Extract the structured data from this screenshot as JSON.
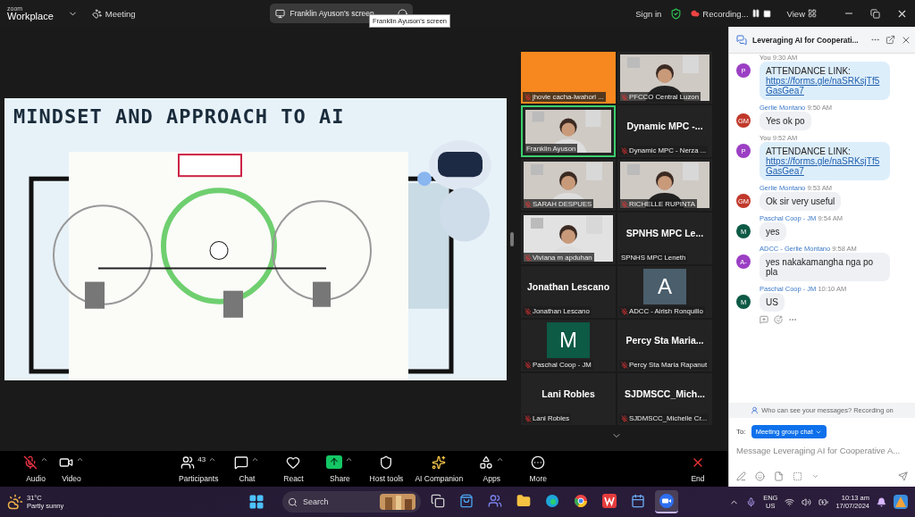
{
  "title_bar": {
    "brand_small": "zoom",
    "brand": "Workplace",
    "meeting_menu": "Meeting",
    "share_pill": "Franklin Ayuson's screen",
    "tooltip": "Franklin Ayuson's screen",
    "sign_in": "Sign in",
    "recording": "Recording...",
    "view": "View"
  },
  "slide": {
    "title": "MINDSET AND APPROACH TO AI"
  },
  "gallery": {
    "tiles": [
      {
        "kind": "color",
        "color": "#f7881f",
        "label": "jhovie cacha-Iwahori ...",
        "muted": true,
        "speaking": false
      },
      {
        "kind": "video",
        "label": "PFCCO Central Luzon",
        "muted": true,
        "speaking": false
      },
      {
        "kind": "video",
        "label": "Franklin Ayuson",
        "muted": false,
        "speaking": true
      },
      {
        "kind": "name",
        "name": "Dynamic MPC -...",
        "label": "Dynamic MPC - Nerza ...",
        "muted": true,
        "speaking": false
      },
      {
        "kind": "video",
        "label": "SARAH DESPUES",
        "muted": true,
        "speaking": false
      },
      {
        "kind": "video",
        "label": "RICHELLE RUPINTA",
        "muted": true,
        "speaking": false
      },
      {
        "kind": "video",
        "label": "Viviana m apduhan",
        "muted": true,
        "speaking": false
      },
      {
        "kind": "name",
        "name": "SPNHS MPC Le...",
        "label": "SPNHS MPC Leneth",
        "muted": false,
        "speaking": false
      },
      {
        "kind": "name",
        "name": "Jonathan Lescano",
        "label": "Jonathan Lescano",
        "muted": true,
        "speaking": false
      },
      {
        "kind": "avatar",
        "letter": "A",
        "color": "#4a5e6c",
        "label": "ADCC - Airish Ronquillo",
        "muted": true,
        "speaking": false
      },
      {
        "kind": "avatar",
        "letter": "M",
        "color": "#0d5a45",
        "label": "Paschal Coop - JM",
        "muted": true,
        "speaking": false
      },
      {
        "kind": "name",
        "name": "Percy Sta Maria...",
        "label": "Percy Sta Maria Rapanut",
        "muted": true,
        "speaking": false
      },
      {
        "kind": "name",
        "name": "Lani Robles",
        "label": "Lani Robles",
        "muted": true,
        "speaking": false
      },
      {
        "kind": "name",
        "name": "SJDMSCC_Mich...",
        "label": "SJDMSCC_Michelle Cr...",
        "muted": true,
        "speaking": false
      }
    ]
  },
  "chat": {
    "title": "Leveraging AI for Cooperati...",
    "messages": [
      {
        "sender": "You",
        "self": true,
        "time": "9:30 AM",
        "avatar": "P",
        "color": "#9b3fc4",
        "text": "ATTENDANCE LINK:",
        "link": "https://forms.gle/naSRKsjTf5GasGea7"
      },
      {
        "sender": "Gerlie Montano",
        "self": false,
        "time": "9:50 AM",
        "avatar": "GM",
        "color": "#c0392b",
        "text": "Yes ok po"
      },
      {
        "sender": "You",
        "self": true,
        "time": "9:52 AM",
        "avatar": "P",
        "color": "#9b3fc4",
        "text": "ATTENDANCE LINK:",
        "link": "https://forms.gle/naSRKsjTf5GasGea7"
      },
      {
        "sender": "Gerlie Montano",
        "self": false,
        "time": "9:53 AM",
        "avatar": "GM",
        "color": "#c0392b",
        "text": "Ok sir very useful"
      },
      {
        "sender": "Paschal Coop - JM",
        "self": false,
        "time": "9:54 AM",
        "avatar": "M",
        "color": "#0d5a45",
        "text": "yes"
      },
      {
        "sender": "ADCC - Gerlie Montano",
        "self": false,
        "time": "9:58 AM",
        "avatar": "A-",
        "color": "#9b3fc4",
        "text": "yes nakakamangha nga po pla"
      },
      {
        "sender": "Paschal Coop - JM",
        "self": false,
        "time": "10:10 AM",
        "avatar": "M",
        "color": "#0d5a45",
        "text": "US"
      }
    ],
    "privacy_note": "Who can see your messages? Recording on",
    "to_label": "To:",
    "recipient": "Meeting group chat",
    "placeholder": "Message Leveraging AI for Cooperative A..."
  },
  "toolbar": {
    "buttons": [
      {
        "kind": "audio",
        "label": "Audio",
        "muted": true,
        "caret": true
      },
      {
        "kind": "video",
        "label": "Video",
        "caret": true
      },
      {
        "kind": "participants",
        "label": "Participants",
        "count": "43",
        "caret": true
      },
      {
        "kind": "chat",
        "label": "Chat",
        "caret": true
      },
      {
        "kind": "react",
        "label": "React",
        "caret": false
      },
      {
        "kind": "share",
        "label": "Share",
        "caret": true
      },
      {
        "kind": "host",
        "label": "Host tools",
        "caret": false
      },
      {
        "kind": "ai",
        "label": "AI Companion",
        "caret": false
      },
      {
        "kind": "apps",
        "label": "Apps",
        "caret": true
      },
      {
        "kind": "more",
        "label": "More",
        "caret": false
      },
      {
        "kind": "end",
        "label": "End",
        "caret": false
      }
    ]
  },
  "taskbar": {
    "weather_temp": "31°C",
    "weather_text": "Partly sunny",
    "search": "Search",
    "apps": [
      {
        "kind": "taskview",
        "selected": false
      },
      {
        "kind": "store",
        "selected": false
      },
      {
        "kind": "teams",
        "selected": false
      },
      {
        "kind": "folder",
        "selected": false
      },
      {
        "kind": "edge",
        "selected": false
      },
      {
        "kind": "chrome",
        "selected": false
      },
      {
        "kind": "wps",
        "selected": false
      },
      {
        "kind": "calendar",
        "selected": false
      },
      {
        "kind": "zoom",
        "selected": true
      }
    ],
    "lang": "ENG",
    "region": "US",
    "time": "10:13 am",
    "date": "17/07/2024"
  }
}
